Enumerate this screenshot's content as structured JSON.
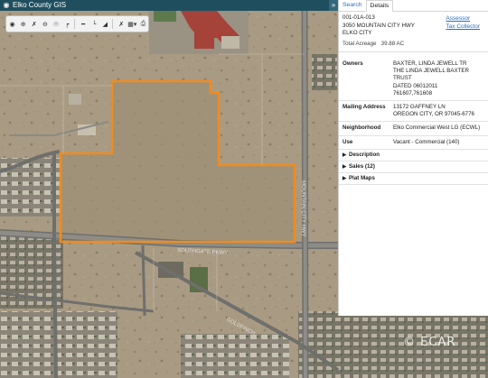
{
  "app": {
    "title": "Elko County GIS",
    "globe_icon": "globe-icon",
    "collapse_icon": "double-chevron-right-icon"
  },
  "toolbar": {
    "tools": [
      "home-icon",
      "zoom-in-icon",
      "zoom-extent-icon",
      "zoom-out-icon",
      "identify-icon",
      "measure-area-icon",
      "measure-distance-icon",
      "draw-line-icon",
      "draw-polygon-icon",
      "select-icon",
      "dropdown-icon",
      "print-icon"
    ]
  },
  "panel": {
    "tabs": [
      "Search",
      "Details"
    ],
    "active_tab": "Details",
    "parcel_id": "001-01A-013",
    "address": "3050 MOUNTAIN CITY HWY",
    "city": "ELKO CITY",
    "acreage_label": "Total Acreage",
    "acreage_value": "39.88 AC",
    "assessor_link": "Assessor",
    "tax_link": "Tax Collector",
    "owners_label": "Owners",
    "owners": [
      "BAXTER, LINDA JEWELL TR",
      "THE LINDA JEWELL BAXTER TRUST",
      "DATED 06012011",
      "761607,761608"
    ],
    "mailing_label": "Mailing Address",
    "mailing": [
      "13172 GAFFNEY LN",
      "OREGON CITY, OR 97045-6776"
    ],
    "neighborhood_label": "Neighborhood",
    "neighborhood": "Elko Commercial West LG (ECWL)",
    "use_label": "Use",
    "use": "Vacant - Commercial (140)",
    "expanders": [
      "Description",
      "Sales (12)",
      "Plat Maps"
    ]
  },
  "map": {
    "roads": [
      "MOUNTAIN CITY HWY",
      "SOUTHGATE PKWY",
      "GOLDFINCH"
    ],
    "parcel_outline_color": "#f08c1e",
    "watermark": "© ECAR"
  }
}
